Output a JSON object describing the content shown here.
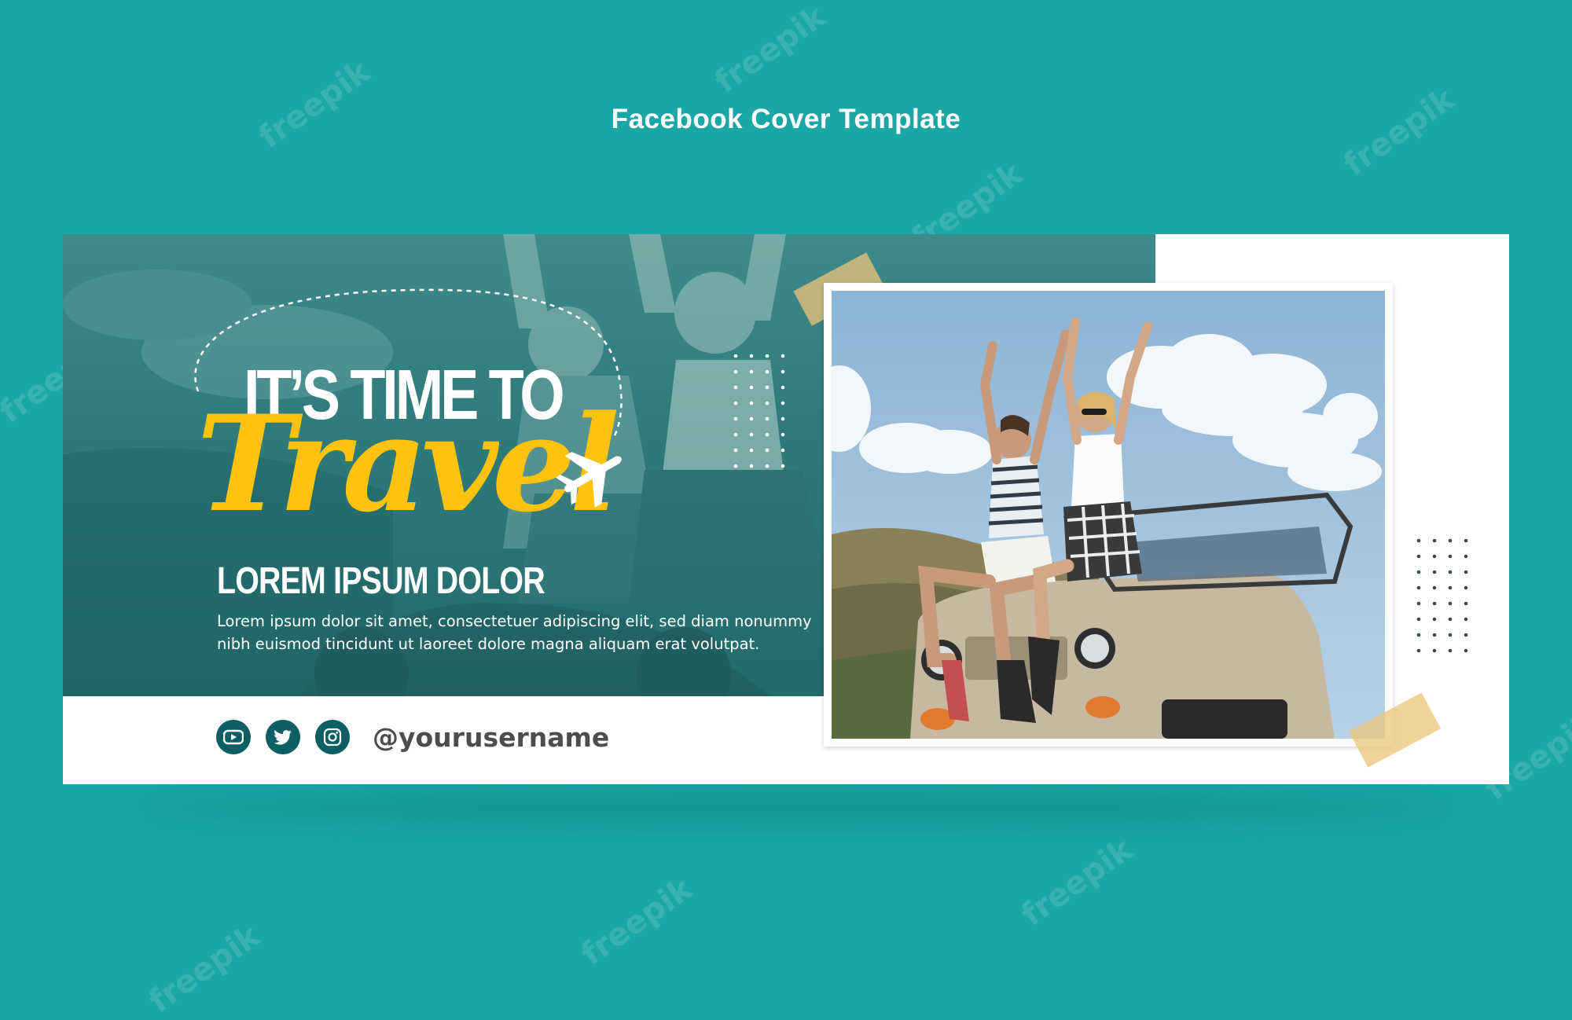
{
  "header": {
    "title": "Facebook Cover Template"
  },
  "cover": {
    "headline_line1": "IT’S TIME TO",
    "headline_line2": "Travel",
    "subheading": "LOREM IPSUM DOLOR",
    "body_line1": "Lorem ipsum dolor sit amet, consectetuer adipiscing elit, sed diam nonummy",
    "body_line2": "nibh euismod tincidunt ut laoreet dolore magna aliquam erat volutpat.",
    "username": "@yourusername",
    "social_icons": [
      "youtube-icon",
      "twitter-icon",
      "instagram-icon"
    ]
  },
  "watermark": "freepik",
  "colors": {
    "background": "#1aa7a6",
    "panel": "#236f70",
    "accent_yellow": "#ffc20e",
    "social_circle": "#0d5f63",
    "card": "#ffffff"
  }
}
